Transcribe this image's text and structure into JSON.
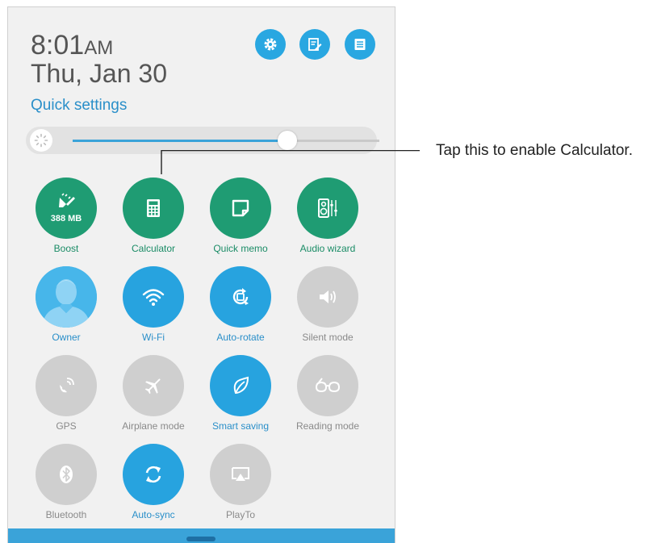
{
  "status": {
    "time": "8:01",
    "ampm": "AM",
    "date": "Thu, Jan 30"
  },
  "quick_settings_link": "Quick settings",
  "header_buttons": [
    {
      "name": "settings-icon"
    },
    {
      "name": "edit-icon"
    },
    {
      "name": "notes-icon"
    }
  ],
  "brightness": {
    "level": 0.7
  },
  "tiles": {
    "boost": {
      "label": "Boost",
      "value": "388 MB",
      "state": "green"
    },
    "calculator": {
      "label": "Calculator",
      "state": "green"
    },
    "quick_memo": {
      "label": "Quick memo",
      "state": "green"
    },
    "audio_wizard": {
      "label": "Audio wizard",
      "state": "green"
    },
    "owner": {
      "label": "Owner",
      "state": "blue"
    },
    "wifi": {
      "label": "Wi-Fi",
      "state": "blue"
    },
    "auto_rotate": {
      "label": "Auto-rotate",
      "state": "blue"
    },
    "silent_mode": {
      "label": "Silent mode",
      "state": "grey"
    },
    "gps": {
      "label": "GPS",
      "state": "grey"
    },
    "airplane_mode": {
      "label": "Airplane mode",
      "state": "grey"
    },
    "smart_saving": {
      "label": "Smart saving",
      "state": "blue"
    },
    "reading_mode": {
      "label": "Reading mode",
      "state": "grey"
    },
    "bluetooth": {
      "label": "Bluetooth",
      "state": "grey"
    },
    "auto_sync": {
      "label": "Auto-sync",
      "state": "blue"
    },
    "playto": {
      "label": "PlayTo",
      "state": "grey"
    }
  },
  "callout": {
    "text": "Tap this to enable Calculator."
  },
  "colors": {
    "green": "#1f9c73",
    "blue": "#27a3df",
    "grey": "#cfcfcf",
    "accent_text": "#2a8fc9"
  }
}
